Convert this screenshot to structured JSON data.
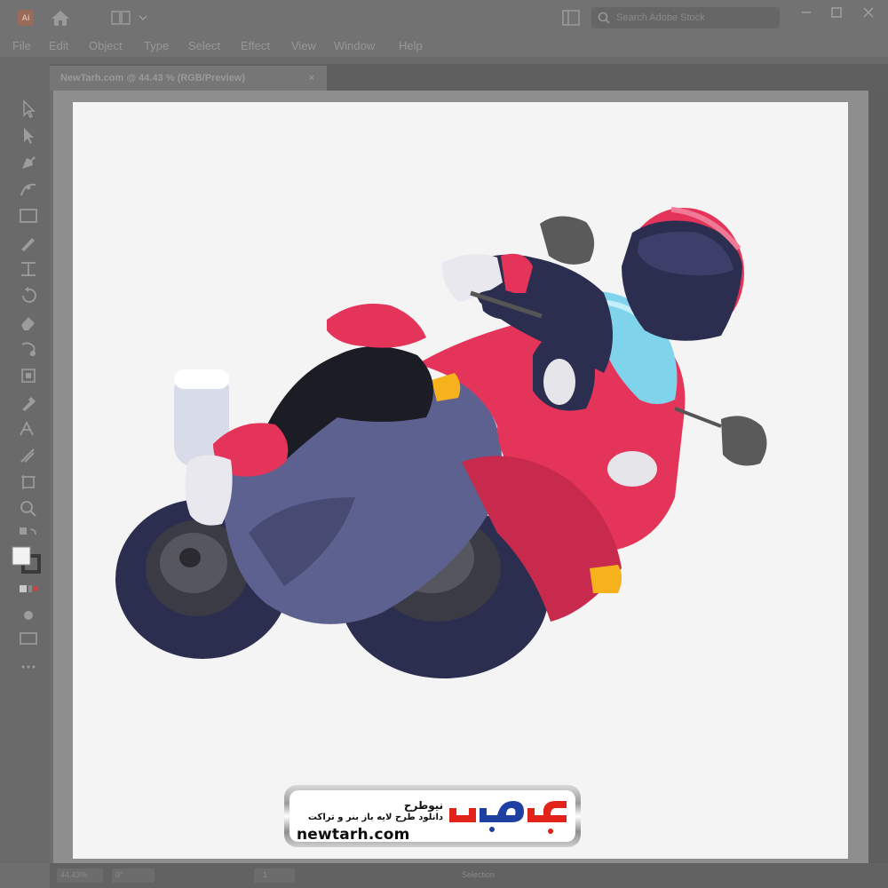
{
  "window": {
    "app_icon": "Ai",
    "search_placeholder": "Search Adobe Stock"
  },
  "menu": [
    {
      "label": "File"
    },
    {
      "label": "Edit"
    },
    {
      "label": "Object"
    },
    {
      "label": "Type"
    },
    {
      "label": "Select"
    },
    {
      "label": "Effect"
    },
    {
      "label": "View"
    },
    {
      "label": "Window"
    },
    {
      "label": "Help"
    }
  ],
  "document_tab": {
    "title": "NewTarh.com @ 44.43 % (RGB/Preview)",
    "close": "×"
  },
  "status": {
    "zoom": "44.43%",
    "rotation": "0°",
    "artboard": "1",
    "tool": "Selection"
  },
  "watermark": {
    "fa_title": "نیوطرح",
    "fa_subtitle": "دانلود طرح لایه باز بنر و تراکت",
    "url": "newtarh.com",
    "logo_text": "نیوطرح",
    "colors": {
      "red": "#e2231a",
      "blue": "#1f3fa3"
    }
  },
  "artwork": {
    "colors": {
      "body_red": "#e5345a",
      "dark_navy": "#2c2e4f",
      "fairing": "#5d6190",
      "windshield": "#7fd3ea",
      "indicator": "#f5b21c"
    }
  },
  "icons": [
    "home-icon",
    "workspace-icon",
    "arrange-panel-icon",
    "search-icon",
    "minimize-icon",
    "maximize-icon"
  ]
}
